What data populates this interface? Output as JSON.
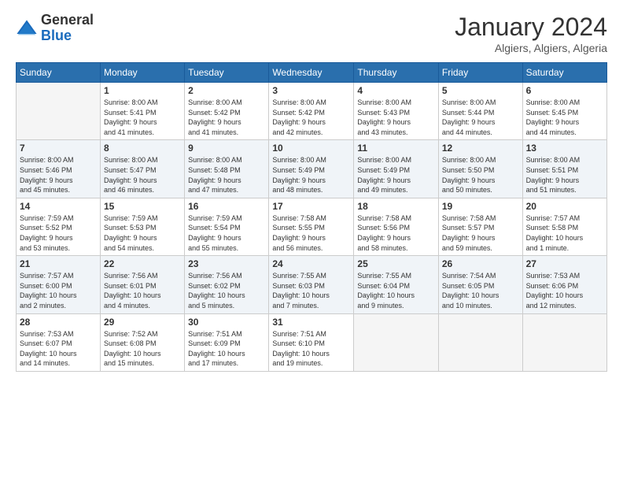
{
  "header": {
    "logo_general": "General",
    "logo_blue": "Blue",
    "month_title": "January 2024",
    "location": "Algiers, Algiers, Algeria"
  },
  "weekdays": [
    "Sunday",
    "Monday",
    "Tuesday",
    "Wednesday",
    "Thursday",
    "Friday",
    "Saturday"
  ],
  "weeks": [
    [
      {
        "day": "",
        "info": ""
      },
      {
        "day": "1",
        "info": "Sunrise: 8:00 AM\nSunset: 5:41 PM\nDaylight: 9 hours\nand 41 minutes."
      },
      {
        "day": "2",
        "info": "Sunrise: 8:00 AM\nSunset: 5:42 PM\nDaylight: 9 hours\nand 41 minutes."
      },
      {
        "day": "3",
        "info": "Sunrise: 8:00 AM\nSunset: 5:42 PM\nDaylight: 9 hours\nand 42 minutes."
      },
      {
        "day": "4",
        "info": "Sunrise: 8:00 AM\nSunset: 5:43 PM\nDaylight: 9 hours\nand 43 minutes."
      },
      {
        "day": "5",
        "info": "Sunrise: 8:00 AM\nSunset: 5:44 PM\nDaylight: 9 hours\nand 44 minutes."
      },
      {
        "day": "6",
        "info": "Sunrise: 8:00 AM\nSunset: 5:45 PM\nDaylight: 9 hours\nand 44 minutes."
      }
    ],
    [
      {
        "day": "7",
        "info": "Sunrise: 8:00 AM\nSunset: 5:46 PM\nDaylight: 9 hours\nand 45 minutes."
      },
      {
        "day": "8",
        "info": "Sunrise: 8:00 AM\nSunset: 5:47 PM\nDaylight: 9 hours\nand 46 minutes."
      },
      {
        "day": "9",
        "info": "Sunrise: 8:00 AM\nSunset: 5:48 PM\nDaylight: 9 hours\nand 47 minutes."
      },
      {
        "day": "10",
        "info": "Sunrise: 8:00 AM\nSunset: 5:49 PM\nDaylight: 9 hours\nand 48 minutes."
      },
      {
        "day": "11",
        "info": "Sunrise: 8:00 AM\nSunset: 5:49 PM\nDaylight: 9 hours\nand 49 minutes."
      },
      {
        "day": "12",
        "info": "Sunrise: 8:00 AM\nSunset: 5:50 PM\nDaylight: 9 hours\nand 50 minutes."
      },
      {
        "day": "13",
        "info": "Sunrise: 8:00 AM\nSunset: 5:51 PM\nDaylight: 9 hours\nand 51 minutes."
      }
    ],
    [
      {
        "day": "14",
        "info": "Sunrise: 7:59 AM\nSunset: 5:52 PM\nDaylight: 9 hours\nand 53 minutes."
      },
      {
        "day": "15",
        "info": "Sunrise: 7:59 AM\nSunset: 5:53 PM\nDaylight: 9 hours\nand 54 minutes."
      },
      {
        "day": "16",
        "info": "Sunrise: 7:59 AM\nSunset: 5:54 PM\nDaylight: 9 hours\nand 55 minutes."
      },
      {
        "day": "17",
        "info": "Sunrise: 7:58 AM\nSunset: 5:55 PM\nDaylight: 9 hours\nand 56 minutes."
      },
      {
        "day": "18",
        "info": "Sunrise: 7:58 AM\nSunset: 5:56 PM\nDaylight: 9 hours\nand 58 minutes."
      },
      {
        "day": "19",
        "info": "Sunrise: 7:58 AM\nSunset: 5:57 PM\nDaylight: 9 hours\nand 59 minutes."
      },
      {
        "day": "20",
        "info": "Sunrise: 7:57 AM\nSunset: 5:58 PM\nDaylight: 10 hours\nand 1 minute."
      }
    ],
    [
      {
        "day": "21",
        "info": "Sunrise: 7:57 AM\nSunset: 6:00 PM\nDaylight: 10 hours\nand 2 minutes."
      },
      {
        "day": "22",
        "info": "Sunrise: 7:56 AM\nSunset: 6:01 PM\nDaylight: 10 hours\nand 4 minutes."
      },
      {
        "day": "23",
        "info": "Sunrise: 7:56 AM\nSunset: 6:02 PM\nDaylight: 10 hours\nand 5 minutes."
      },
      {
        "day": "24",
        "info": "Sunrise: 7:55 AM\nSunset: 6:03 PM\nDaylight: 10 hours\nand 7 minutes."
      },
      {
        "day": "25",
        "info": "Sunrise: 7:55 AM\nSunset: 6:04 PM\nDaylight: 10 hours\nand 9 minutes."
      },
      {
        "day": "26",
        "info": "Sunrise: 7:54 AM\nSunset: 6:05 PM\nDaylight: 10 hours\nand 10 minutes."
      },
      {
        "day": "27",
        "info": "Sunrise: 7:53 AM\nSunset: 6:06 PM\nDaylight: 10 hours\nand 12 minutes."
      }
    ],
    [
      {
        "day": "28",
        "info": "Sunrise: 7:53 AM\nSunset: 6:07 PM\nDaylight: 10 hours\nand 14 minutes."
      },
      {
        "day": "29",
        "info": "Sunrise: 7:52 AM\nSunset: 6:08 PM\nDaylight: 10 hours\nand 15 minutes."
      },
      {
        "day": "30",
        "info": "Sunrise: 7:51 AM\nSunset: 6:09 PM\nDaylight: 10 hours\nand 17 minutes."
      },
      {
        "day": "31",
        "info": "Sunrise: 7:51 AM\nSunset: 6:10 PM\nDaylight: 10 hours\nand 19 minutes."
      },
      {
        "day": "",
        "info": ""
      },
      {
        "day": "",
        "info": ""
      },
      {
        "day": "",
        "info": ""
      }
    ]
  ]
}
